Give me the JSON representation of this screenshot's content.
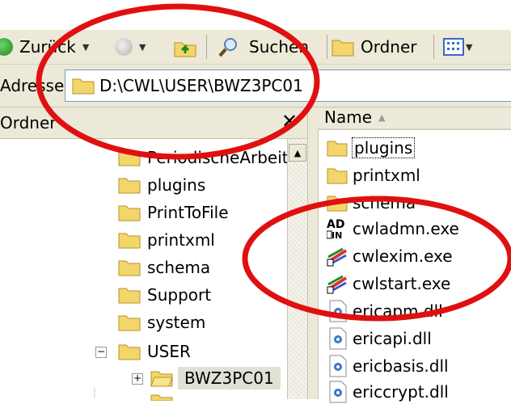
{
  "toolbar": {
    "back_label": "Zurück",
    "search_label": "Suchen",
    "folders_label": "Ordner"
  },
  "address": {
    "label": "Adresse",
    "path": "D:\\CWL\\USER\\BWZ3PC01"
  },
  "folder_pane": {
    "title": "Ordner",
    "close_glyph": "✕",
    "items": [
      {
        "label": "PeriodischeArbeit"
      },
      {
        "label": "plugins"
      },
      {
        "label": "PrintToFile"
      },
      {
        "label": "printxml"
      },
      {
        "label": "schema"
      },
      {
        "label": "Support"
      },
      {
        "label": "system"
      },
      {
        "label": "USER"
      },
      {
        "label": "BWZ3PC01"
      }
    ]
  },
  "file_list": {
    "column_name": "Name",
    "files": [
      {
        "label": "plugins",
        "icon": "folder-icon"
      },
      {
        "label": "printxml",
        "icon": "folder-icon"
      },
      {
        "label": "schema",
        "icon": "folder-icon"
      },
      {
        "label": "cwladmn.exe",
        "icon": "admin-exe-icon"
      },
      {
        "label": "cwlexim.exe",
        "icon": "app-exe-icon"
      },
      {
        "label": "cwlstart.exe",
        "icon": "app-exe-icon"
      },
      {
        "label": "ericapm.dll",
        "icon": "dll-icon"
      },
      {
        "label": "ericapi.dll",
        "icon": "dll-icon"
      },
      {
        "label": "ericbasis.dll",
        "icon": "dll-icon"
      },
      {
        "label": "ericcrypt.dll",
        "icon": "dll-icon"
      }
    ]
  },
  "annotation_color": "#e01010"
}
